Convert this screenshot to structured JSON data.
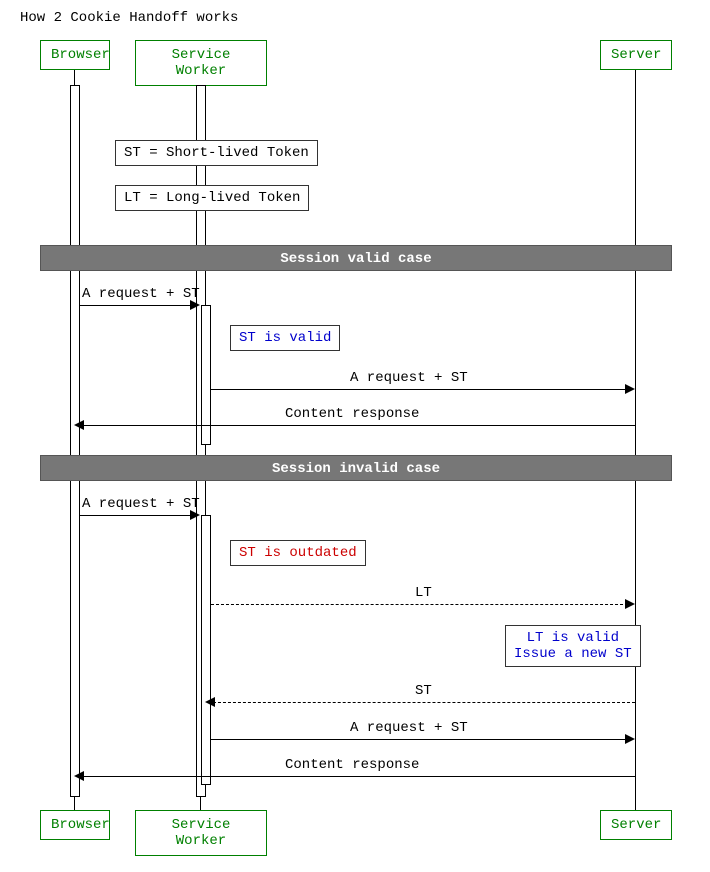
{
  "title": "How 2 Cookie Handoff works",
  "participants": {
    "browser": "Browser",
    "service_worker": "Service Worker",
    "server": "Server"
  },
  "notes": {
    "st_def": "ST = Short-lived Token",
    "lt_def": "LT = Long-lived Token",
    "st_valid": "ST is valid",
    "st_outdated": "ST is outdated",
    "lt_valid_line1": "LT is valid",
    "lt_valid_line2": "Issue a new ST"
  },
  "dividers": {
    "valid": "Session valid case",
    "invalid": "Session invalid case"
  },
  "messages": {
    "req_st": "A request + ST",
    "req_st2": "A request + ST",
    "content": "Content response",
    "req_st3": "A request + ST",
    "lt": "LT",
    "st": "ST",
    "req_st4": "A request + ST",
    "content2": "Content response"
  },
  "chart_data": {
    "type": "sequence-diagram",
    "title": "How 2 Cookie Handoff works",
    "participants": [
      "Browser",
      "Service Worker",
      "Server"
    ],
    "definitions": [
      "ST = Short-lived Token",
      "LT = Long-lived Token"
    ],
    "sections": [
      {
        "label": "Session valid case",
        "events": [
          {
            "type": "message",
            "from": "Browser",
            "to": "Service Worker",
            "label": "A request + ST",
            "style": "solid"
          },
          {
            "type": "note",
            "over": "Service Worker",
            "text": "ST is valid",
            "color": "blue"
          },
          {
            "type": "message",
            "from": "Service Worker",
            "to": "Server",
            "label": "A request + ST",
            "style": "solid"
          },
          {
            "type": "message",
            "from": "Server",
            "to": "Browser",
            "label": "Content response",
            "style": "solid"
          }
        ]
      },
      {
        "label": "Session invalid case",
        "events": [
          {
            "type": "message",
            "from": "Browser",
            "to": "Service Worker",
            "label": "A request + ST",
            "style": "solid"
          },
          {
            "type": "note",
            "over": "Service Worker",
            "text": "ST is outdated",
            "color": "red"
          },
          {
            "type": "message",
            "from": "Service Worker",
            "to": "Server",
            "label": "LT",
            "style": "dashed"
          },
          {
            "type": "note",
            "over": "Server",
            "text": "LT is valid\nIssue a new ST",
            "color": "blue"
          },
          {
            "type": "message",
            "from": "Server",
            "to": "Service Worker",
            "label": "ST",
            "style": "dashed"
          },
          {
            "type": "message",
            "from": "Service Worker",
            "to": "Server",
            "label": "A request + ST",
            "style": "solid"
          },
          {
            "type": "message",
            "from": "Server",
            "to": "Browser",
            "label": "Content response",
            "style": "solid"
          }
        ]
      }
    ]
  }
}
